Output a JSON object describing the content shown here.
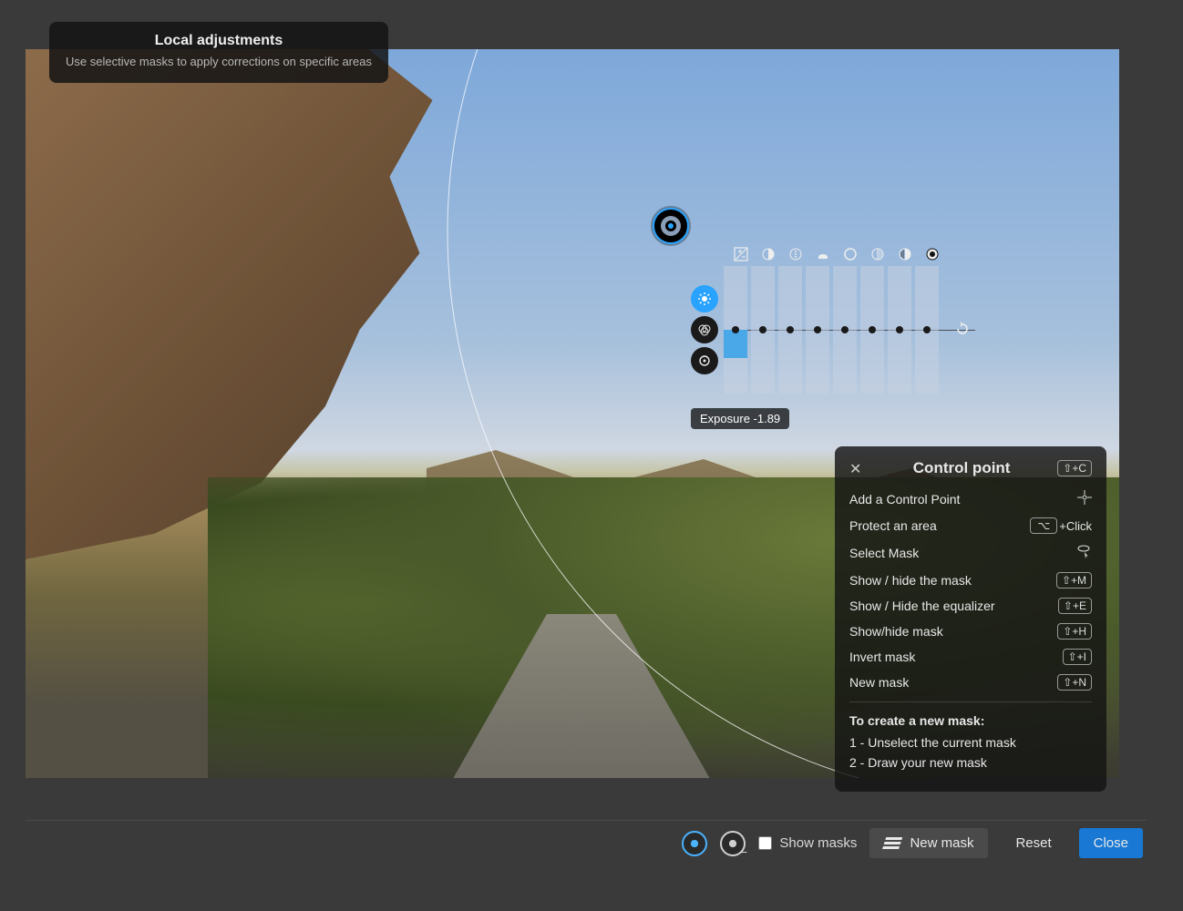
{
  "tooltip": {
    "title": "Local adjustments",
    "subtitle": "Use selective masks to apply corrections on specific areas"
  },
  "equalizer": {
    "icons": [
      "exposure-icon",
      "contrast-icon",
      "microcontrast-icon",
      "clearview-icon",
      "highlights-icon",
      "midtones-icon",
      "shadows-icon",
      "blacks-icon"
    ],
    "tabs": [
      "light-tab",
      "color-tab",
      "detail-tab"
    ],
    "active_tab": 0,
    "columns": [
      {
        "value": -1.89,
        "fill_top_pct": 50,
        "fill_height_pct": 22
      },
      {
        "value": 0,
        "fill_top_pct": 50,
        "fill_height_pct": 0
      },
      {
        "value": 0,
        "fill_top_pct": 50,
        "fill_height_pct": 0
      },
      {
        "value": 0,
        "fill_top_pct": 50,
        "fill_height_pct": 0
      },
      {
        "value": 0,
        "fill_top_pct": 50,
        "fill_height_pct": 0
      },
      {
        "value": 0,
        "fill_top_pct": 50,
        "fill_height_pct": 0
      },
      {
        "value": 0,
        "fill_top_pct": 50,
        "fill_height_pct": 0
      },
      {
        "value": 0,
        "fill_top_pct": 50,
        "fill_height_pct": 0
      }
    ],
    "readout": "Exposure -1.89"
  },
  "help": {
    "title": "Control point",
    "title_shortcut": "⇧+C",
    "items": [
      {
        "label": "Add a Control Point",
        "shortcut": "",
        "icon": "target-icon"
      },
      {
        "label": "Protect an area",
        "shortcut": "⌥ +Click",
        "kbd_has_text": true
      },
      {
        "label": "Select Mask",
        "shortcut": "",
        "icon": "lasso-cursor-icon"
      },
      {
        "label": "Show / hide the mask",
        "shortcut": "⇧+M"
      },
      {
        "label": "Show / Hide the equalizer",
        "shortcut": "⇧+E"
      },
      {
        "label": "Show/hide mask",
        "shortcut": "⇧+H"
      },
      {
        "label": "Invert mask",
        "shortcut": "⇧+I"
      },
      {
        "label": "New mask",
        "shortcut": "⇧+N"
      }
    ],
    "instructions_title": "To create a new mask:",
    "instructions": [
      "1 - Unselect the current mask",
      "2 - Draw your new mask"
    ]
  },
  "bottombar": {
    "show_masks_label": "Show masks",
    "show_masks_checked": false,
    "new_mask_label": "New mask",
    "reset_label": "Reset",
    "close_label": "Close"
  },
  "colors": {
    "accent": "#29a3ff",
    "primary_button": "#1878d4"
  }
}
